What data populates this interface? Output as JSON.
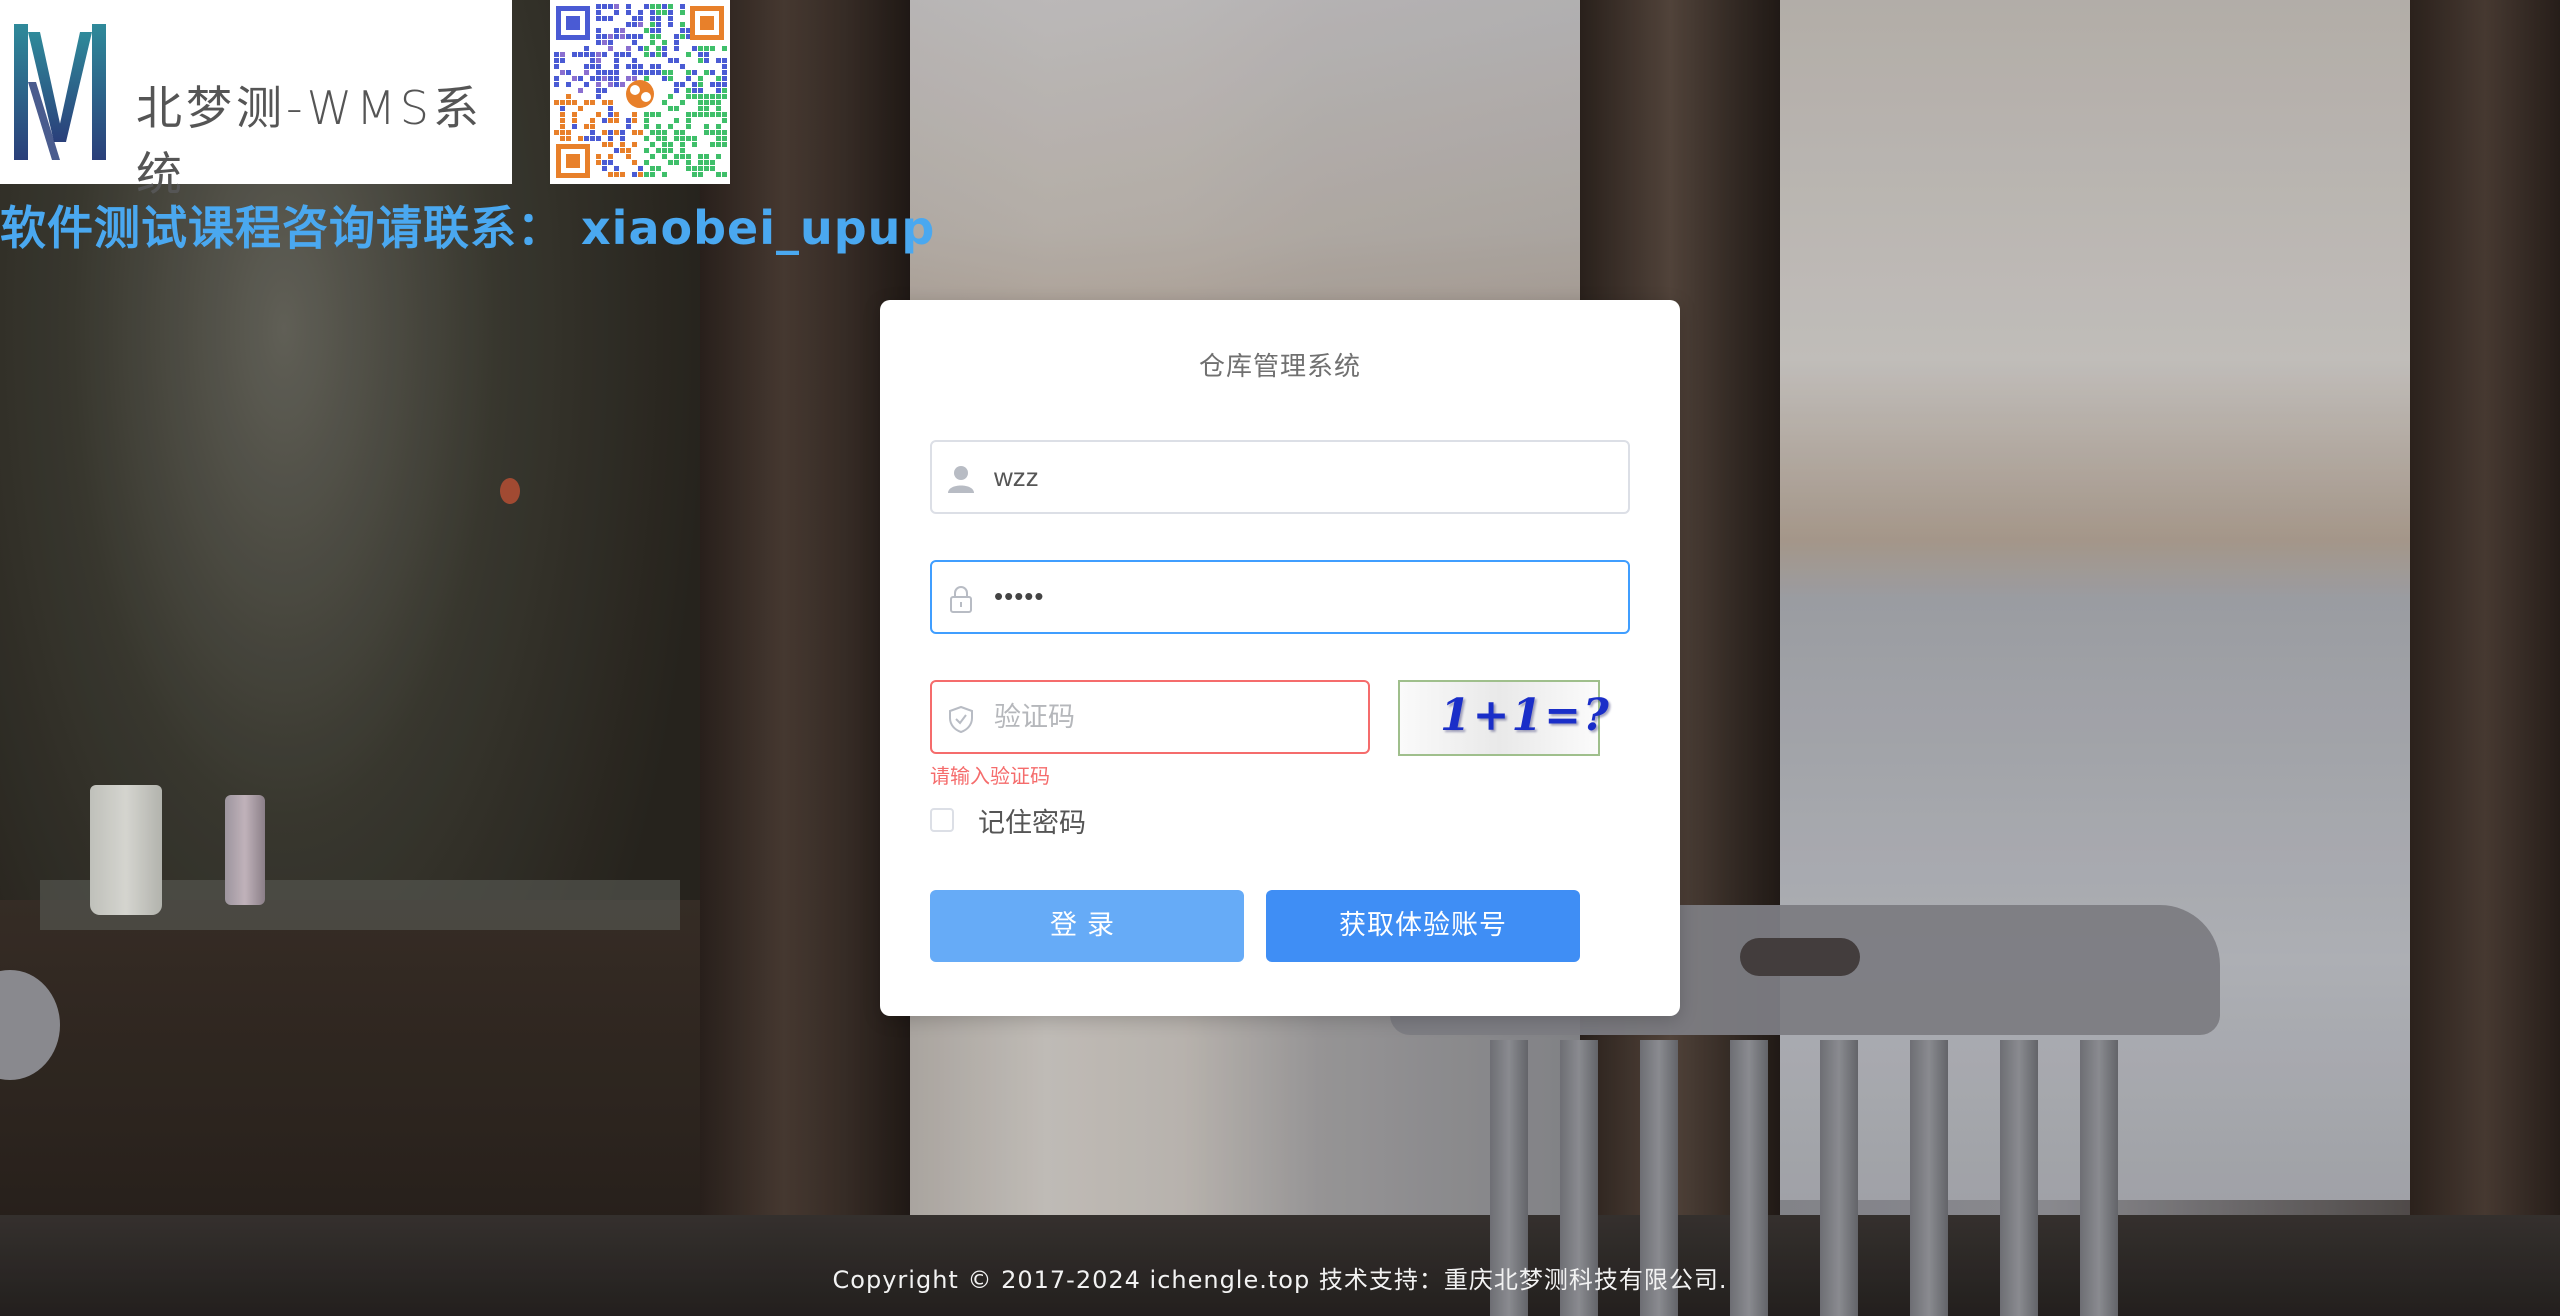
{
  "brand": {
    "logo_text": "北梦测-WMS系统",
    "contact": "软件测试课程咨询请联系： xiaobei_upup"
  },
  "login": {
    "title": "仓库管理系统",
    "username_value": "wzz",
    "password_mask": "•••••",
    "captcha_placeholder": "验证码",
    "captcha_image_text": "1+1=?",
    "captcha_error": "请输入验证码",
    "remember_label": "记住密码",
    "remember_checked": false,
    "login_button": "登录",
    "trial_button": "获取体验账号"
  },
  "footer": {
    "copyright": "Copyright © 2017-2024 ichengle.top 技术支持：重庆北梦测科技有限公司."
  },
  "colors": {
    "primary": "#409eff",
    "login_button": "#66abf7",
    "trial_button": "#3f8ef5",
    "error": "#f56c6c",
    "contact_text": "#4aa8f0"
  },
  "icons": {
    "username": "user-icon",
    "password": "lock-icon",
    "captcha": "shield-check-icon"
  }
}
